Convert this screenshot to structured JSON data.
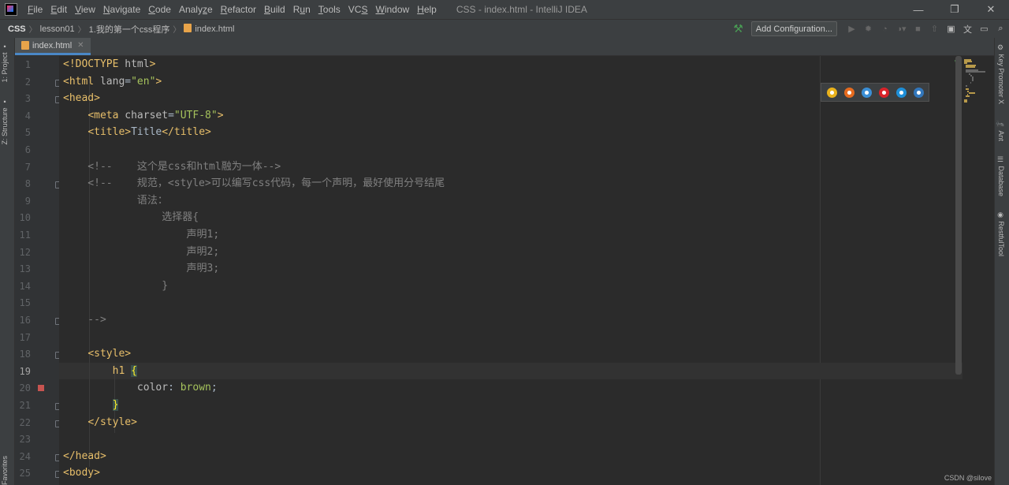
{
  "window": {
    "title": "CSS - index.html - IntelliJ IDEA",
    "controls": [
      "—",
      "❐",
      "✕"
    ]
  },
  "menu": [
    {
      "label": "File",
      "ul": "F"
    },
    {
      "label": "Edit",
      "ul": "E"
    },
    {
      "label": "View",
      "ul": "V"
    },
    {
      "label": "Navigate",
      "ul": "N"
    },
    {
      "label": "Code",
      "ul": "C"
    },
    {
      "label": "Analyze",
      "ul": "z"
    },
    {
      "label": "Refactor",
      "ul": "R"
    },
    {
      "label": "Build",
      "ul": "B"
    },
    {
      "label": "Run",
      "ul": "u"
    },
    {
      "label": "Tools",
      "ul": "T"
    },
    {
      "label": "VCS",
      "ul": "S"
    },
    {
      "label": "Window",
      "ul": "W"
    },
    {
      "label": "Help",
      "ul": "H"
    }
  ],
  "breadcrumb": [
    "CSS",
    "lesson01",
    "1.我的第一个css程序",
    "index.html"
  ],
  "toolbar": {
    "add_configuration": "Add Configuration..."
  },
  "left_tabs": [
    "1: Project",
    "Z: Structure",
    "Favorites"
  ],
  "right_tabs": [
    "Key Promoter X",
    "Ant",
    "Database",
    "RestfulTool"
  ],
  "editor_tab": {
    "label": "index.html"
  },
  "gutter": {
    "line_numbers": [
      "1",
      "2",
      "3",
      "4",
      "5",
      "6",
      "7",
      "8",
      "9",
      "10",
      "11",
      "12",
      "13",
      "14",
      "15",
      "16",
      "17",
      "18",
      "19",
      "20",
      "21",
      "22",
      "23",
      "24",
      "25"
    ],
    "current_line": 19,
    "breakpoint_line": 20
  },
  "code_lines": [
    [
      [
        "t-tag",
        "<!DOCTYPE "
      ],
      [
        "t-attr",
        "html"
      ],
      [
        "t-tag",
        ">"
      ]
    ],
    [
      [
        "t-tag",
        "<html "
      ],
      [
        "t-attr",
        "lang"
      ],
      [
        "t-text",
        "="
      ],
      [
        "t-str",
        "\"en\""
      ],
      [
        "t-tag",
        ">"
      ]
    ],
    [
      [
        "t-tag",
        "<head>"
      ]
    ],
    [
      [
        "t-text",
        "    "
      ],
      [
        "t-tag",
        "<meta "
      ],
      [
        "t-attr",
        "charset"
      ],
      [
        "t-text",
        "="
      ],
      [
        "t-str",
        "\"UTF-8\""
      ],
      [
        "t-tag",
        ">"
      ]
    ],
    [
      [
        "t-text",
        "    "
      ],
      [
        "t-tag",
        "<title>"
      ],
      [
        "t-text",
        "Title"
      ],
      [
        "t-tag",
        "</title>"
      ]
    ],
    [],
    [
      [
        "t-cmt",
        "    <!--    这个是css和html融为一体-->"
      ]
    ],
    [
      [
        "t-cmt",
        "    <!--    规范，<style>可以编写css代码，每一个声明，最好使用分号结尾"
      ]
    ],
    [
      [
        "t-cmt",
        "            语法："
      ]
    ],
    [
      [
        "t-cmt",
        "                选择器{"
      ]
    ],
    [
      [
        "t-cmt",
        "                    声明1;"
      ]
    ],
    [
      [
        "t-cmt",
        "                    声明2;"
      ]
    ],
    [
      [
        "t-cmt",
        "                    声明3;"
      ]
    ],
    [
      [
        "t-cmt",
        "                }"
      ]
    ],
    [],
    [
      [
        "t-cmt",
        "    -->"
      ]
    ],
    [],
    [
      [
        "t-text",
        "    "
      ],
      [
        "t-tag",
        "<style>"
      ]
    ],
    [
      [
        "t-text",
        "        "
      ],
      [
        "t-sel",
        "h1 "
      ],
      [
        "t-brace hl",
        "{"
      ]
    ],
    [
      [
        "t-text",
        "            "
      ],
      [
        "t-prop",
        "color"
      ],
      [
        "t-text",
        ": "
      ],
      [
        "t-val",
        "brown"
      ],
      [
        "t-text",
        ";"
      ]
    ],
    [
      [
        "t-text",
        "        "
      ],
      [
        "t-brace hl",
        "}"
      ]
    ],
    [
      [
        "t-text",
        "    "
      ],
      [
        "t-tag",
        "</style>"
      ]
    ],
    [],
    [
      [
        "t-tag",
        "</head>"
      ]
    ],
    [
      [
        "t-tag",
        "<body>"
      ]
    ]
  ],
  "browser_icons": [
    "chrome-icon",
    "firefox-icon",
    "safari-icon",
    "opera-icon",
    "ie-icon",
    "edge-icon"
  ],
  "browser_colors": [
    "#e9b21c",
    "#e66b1f",
    "#3b8fd6",
    "#d9232a",
    "#1e8fd8",
    "#3277bc"
  ],
  "watermark": "CSDN @silove"
}
